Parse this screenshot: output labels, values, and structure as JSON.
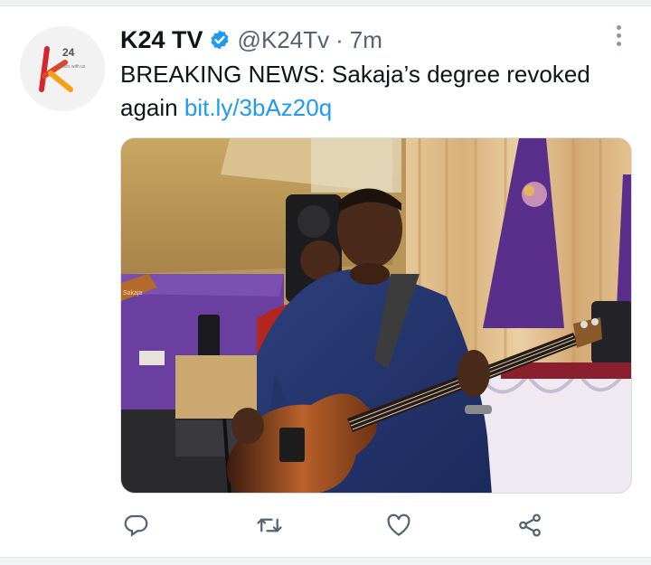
{
  "tweet": {
    "author_name": "K24 TV",
    "handle": "@K24Tv",
    "separator": "·",
    "time": "7m",
    "text": "BREAKING NEWS: Sakaja’s degree revoked again",
    "link": "bit.ly/3bAz20q"
  },
  "avatar": {
    "logo_number": "24",
    "logo_tagline": "Yours with us"
  },
  "media": {
    "speaker_brand": "Sakaja"
  },
  "icons": {
    "verified": "verified-badge-icon",
    "more": "more-vertical-icon",
    "reply": "reply-icon",
    "retweet": "retweet-icon",
    "like": "heart-icon",
    "share": "share-icon"
  },
  "colors": {
    "link": "#1d9bf0",
    "verified": "#1d9bf0",
    "icon": "#536471",
    "brand_orange": "#f6a01a",
    "brand_red": "#d7262b"
  }
}
